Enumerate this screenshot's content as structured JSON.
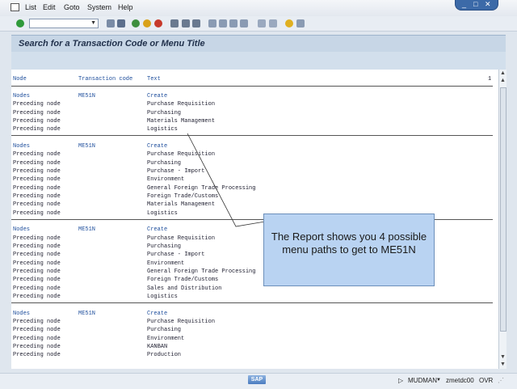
{
  "menubar": {
    "items": [
      "List",
      "Edit",
      "Goto",
      "System",
      "Help"
    ]
  },
  "toolbar": {
    "command_value": ""
  },
  "header": {
    "title": "Search for a Transaction Code or Menu Title"
  },
  "table": {
    "columns": [
      "Node",
      "Transaction code",
      "Text",
      "1"
    ],
    "groups": [
      {
        "rows": [
          [
            "Nodes",
            "ME51N",
            "Create"
          ],
          [
            "Preceding node",
            "",
            "Purchase Requisition"
          ],
          [
            "Preceding node",
            "",
            "Purchasing"
          ],
          [
            "Preceding node",
            "",
            "Materials Management"
          ],
          [
            "Preceding node",
            "",
            "Logistics"
          ]
        ]
      },
      {
        "rows": [
          [
            "Nodes",
            "ME51N",
            "Create"
          ],
          [
            "Preceding node",
            "",
            "Purchase Requisition"
          ],
          [
            "Preceding node",
            "",
            "Purchasing"
          ],
          [
            "Preceding node",
            "",
            "Purchase - Import"
          ],
          [
            "Preceding node",
            "",
            "Environment"
          ],
          [
            "Preceding node",
            "",
            "General Foreign Trade Processing"
          ],
          [
            "Preceding node",
            "",
            "Foreign Trade/Customs"
          ],
          [
            "Preceding node",
            "",
            "Materials Management"
          ],
          [
            "Preceding node",
            "",
            "Logistics"
          ]
        ]
      },
      {
        "rows": [
          [
            "Nodes",
            "ME51N",
            "Create"
          ],
          [
            "Preceding node",
            "",
            "Purchase Requisition"
          ],
          [
            "Preceding node",
            "",
            "Purchasing"
          ],
          [
            "Preceding node",
            "",
            "Purchase - Import"
          ],
          [
            "Preceding node",
            "",
            "Environment"
          ],
          [
            "Preceding node",
            "",
            "General Foreign Trade Processing"
          ],
          [
            "Preceding node",
            "",
            "Foreign Trade/Customs"
          ],
          [
            "Preceding node",
            "",
            "Sales and Distribution"
          ],
          [
            "Preceding node",
            "",
            "Logistics"
          ]
        ]
      },
      {
        "rows": [
          [
            "Nodes",
            "ME51N",
            "Create"
          ],
          [
            "Preceding node",
            "",
            "Purchase Requisition"
          ],
          [
            "Preceding node",
            "",
            "Purchasing"
          ],
          [
            "Preceding node",
            "",
            "Environment"
          ],
          [
            "Preceding node",
            "",
            "KANBAN"
          ],
          [
            "Preceding node",
            "",
            "Production"
          ]
        ]
      }
    ]
  },
  "callout": {
    "text": "The Report shows you 4 possible menu paths to get to ME51N"
  },
  "status": {
    "logo": "SAP",
    "user": "MUDMAN",
    "server": "zmetdc00",
    "mode": "OVR"
  },
  "colors": {
    "accent": "#3c6aa8",
    "header_bg": "#c7d6e6",
    "callout_bg": "#b9d3f2"
  }
}
